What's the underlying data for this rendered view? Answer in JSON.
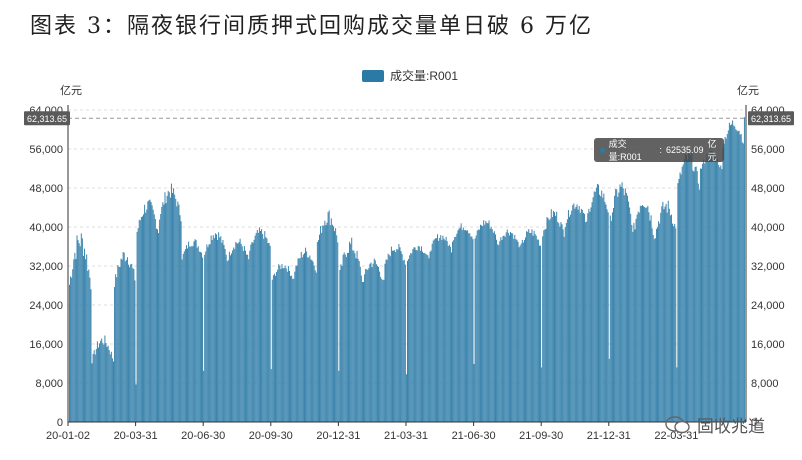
{
  "document": {
    "title": "图表 3：隔夜银行间质押式回购成交量单日破 6 万亿"
  },
  "chart_data": {
    "type": "bar",
    "legend": {
      "label": "成交量:R001",
      "position": "top-center"
    },
    "y_unit_left": "亿元",
    "y_unit_right": "亿元",
    "ylim": [
      0,
      64000
    ],
    "yticks": [
      "0",
      "8,000",
      "16,000",
      "24,000",
      "32,000",
      "40,000",
      "48,000",
      "56,000",
      "64,000"
    ],
    "ytick_values": [
      0,
      8000,
      16000,
      24000,
      32000,
      40000,
      48000,
      56000,
      64000
    ],
    "x_tick_labels": [
      "20-01-02",
      "20-03-31",
      "20-06-30",
      "20-09-30",
      "20-12-31",
      "21-03-31",
      "21-06-30",
      "21-09-30",
      "21-12-31",
      "22-03-31"
    ],
    "reference_line": {
      "label": "62,313.65",
      "value": 62313.65
    },
    "tooltip": {
      "series": "成交量:R001",
      "value": "62535.09",
      "unit": "亿元"
    },
    "grid": true,
    "monthly_profile": [
      {
        "month": "2020-01",
        "low": 18000,
        "high": 40000
      },
      {
        "month": "2020-02",
        "low": 8000,
        "high": 18000
      },
      {
        "month": "2020-03",
        "low": 22000,
        "high": 36000
      },
      {
        "month": "2020-04",
        "low": 33000,
        "high": 46000
      },
      {
        "month": "2020-05",
        "low": 36000,
        "high": 49000
      },
      {
        "month": "2020-06",
        "low": 30000,
        "high": 38000
      },
      {
        "month": "2020-07",
        "low": 30000,
        "high": 40000
      },
      {
        "month": "2020-08",
        "low": 29000,
        "high": 38000
      },
      {
        "month": "2020-09",
        "low": 31000,
        "high": 40000
      },
      {
        "month": "2020-10",
        "low": 26000,
        "high": 33000
      },
      {
        "month": "2020-11",
        "low": 27000,
        "high": 36000
      },
      {
        "month": "2020-12",
        "low": 30000,
        "high": 44000
      },
      {
        "month": "2021-01",
        "low": 24000,
        "high": 38000
      },
      {
        "month": "2021-02",
        "low": 24000,
        "high": 34000
      },
      {
        "month": "2021-03",
        "low": 28000,
        "high": 37000
      },
      {
        "month": "2021-04",
        "low": 30000,
        "high": 37000
      },
      {
        "month": "2021-05",
        "low": 32000,
        "high": 39000
      },
      {
        "month": "2021-06",
        "low": 34000,
        "high": 41000
      },
      {
        "month": "2021-07",
        "low": 34000,
        "high": 42000
      },
      {
        "month": "2021-08",
        "low": 33000,
        "high": 40000
      },
      {
        "month": "2021-09",
        "low": 32000,
        "high": 40000
      },
      {
        "month": "2021-10",
        "low": 34000,
        "high": 44000
      },
      {
        "month": "2021-11",
        "low": 36000,
        "high": 46000
      },
      {
        "month": "2021-12",
        "low": 37000,
        "high": 49000
      },
      {
        "month": "2022-01",
        "low": 34000,
        "high": 50000
      },
      {
        "month": "2022-02",
        "low": 30000,
        "high": 48000
      },
      {
        "month": "2022-03",
        "low": 32000,
        "high": 46000
      },
      {
        "month": "2022-04",
        "low": 42000,
        "high": 56000
      },
      {
        "month": "2022-05",
        "low": 48000,
        "high": 56000
      },
      {
        "month": "2022-06",
        "low": 52000,
        "high": 62535.09
      }
    ]
  },
  "watermark": {
    "text": "固收兆道",
    "icon": "wechat-icon"
  }
}
